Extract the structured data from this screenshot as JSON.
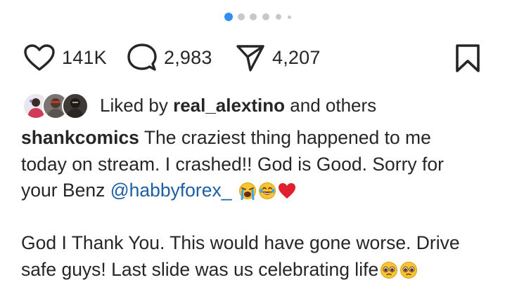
{
  "carousel": {
    "total": 6,
    "active_index": 0
  },
  "actions": {
    "like_count": "141K",
    "comment_count": "2,983",
    "share_count": "4,207"
  },
  "liked_by": {
    "prefix": "Liked by",
    "username": "real_alextino",
    "suffix": "and others"
  },
  "caption": {
    "username": "shankcomics",
    "line1": "The craziest thing happened to me",
    "line2": "today on stream. I crashed!! God is Good. Sorry for",
    "line3_text": "your Benz",
    "mention": "@habbyforex_",
    "line4": "God I Thank You. This would have gone worse. Drive",
    "line5": "safe guys! Last slide was us celebrating life"
  },
  "emojis": [
    "loudly-crying-face",
    "tears-of-joy-face",
    "red-heart",
    "pleading-face",
    "pleading-face"
  ],
  "colors": {
    "accent_blue": "#2f8ff0",
    "mention_blue": "#1d5ea6",
    "heart_red": "#e0202c",
    "text": "#262626"
  }
}
